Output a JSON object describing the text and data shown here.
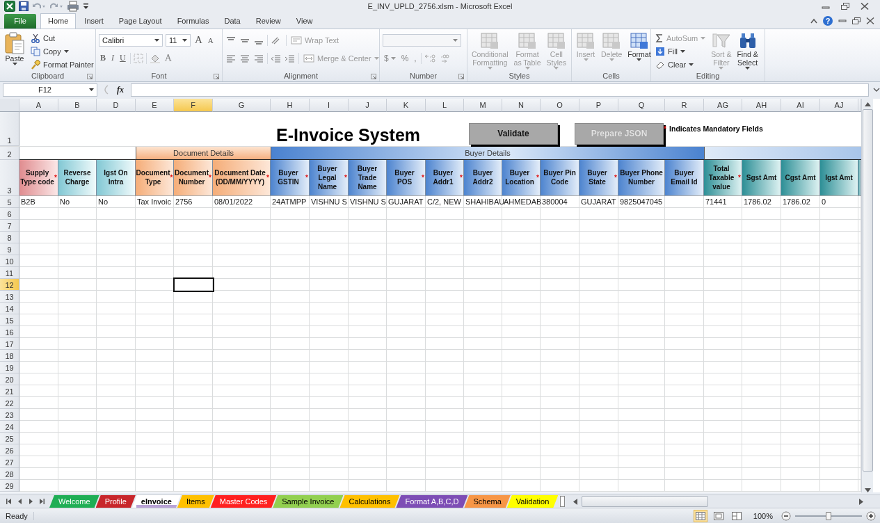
{
  "window": {
    "title": "E_INV_UPLD_2756.xlsm - Microsoft Excel",
    "help_label": "?"
  },
  "ribbon_tabs": [
    {
      "label": "File",
      "kind": "file",
      "selected": false
    },
    {
      "label": "Home",
      "kind": "tab",
      "selected": true
    },
    {
      "label": "Insert",
      "kind": "tab",
      "selected": false
    },
    {
      "label": "Page Layout",
      "kind": "tab",
      "selected": false
    },
    {
      "label": "Formulas",
      "kind": "tab",
      "selected": false
    },
    {
      "label": "Data",
      "kind": "tab",
      "selected": false
    },
    {
      "label": "Review",
      "kind": "tab",
      "selected": false
    },
    {
      "label": "View",
      "kind": "tab",
      "selected": false
    }
  ],
  "ribbon": {
    "groups": [
      {
        "kind": "clipboard",
        "label": "Clipboard",
        "items": [
          {
            "label": "Paste",
            "disabled": false,
            "menu": true
          },
          {
            "label": "Cut",
            "disabled": false,
            "menu": false
          },
          {
            "label": "Copy",
            "disabled": false,
            "menu": true
          },
          {
            "label": "Format Painter",
            "disabled": false,
            "menu": false
          }
        ]
      },
      {
        "kind": "font",
        "label": "Font",
        "font_name": "Calibri",
        "font_size": "11",
        "grow": "A",
        "shrink": "A",
        "styles": [
          "B",
          "I",
          "U"
        ],
        "font_color": "A"
      },
      {
        "kind": "alignment",
        "label": "Alignment",
        "items": [
          {
            "label": "Wrap Text",
            "disabled": true,
            "menu": false
          },
          {
            "label": "Merge & Center",
            "disabled": true,
            "menu": true
          }
        ]
      },
      {
        "kind": "number",
        "label": "Number",
        "symbols": [
          {
            "label": "$",
            "disabled": true,
            "menu": true
          },
          {
            "label": "%",
            "disabled": true,
            "menu": false
          },
          {
            "label": ",",
            "disabled": true,
            "menu": false
          }
        ]
      },
      {
        "kind": "large",
        "label": "Styles",
        "items": [
          {
            "lines": [
              "Conditional",
              "Formatting"
            ],
            "disabled": true,
            "menu": true
          },
          {
            "lines": [
              "Format",
              "as Table"
            ],
            "disabled": true,
            "menu": true
          },
          {
            "lines": [
              "Cell",
              "Styles"
            ],
            "disabled": true,
            "menu": true
          }
        ]
      },
      {
        "kind": "large",
        "label": "Cells",
        "items": [
          {
            "lines": [
              "Insert"
            ],
            "disabled": true,
            "menu": true
          },
          {
            "lines": [
              "Delete"
            ],
            "disabled": true,
            "menu": true
          },
          {
            "lines": [
              "Format"
            ],
            "disabled": false,
            "menu": true
          }
        ]
      },
      {
        "kind": "editing",
        "label": "Editing",
        "items": [
          {
            "label": "AutoSum",
            "disabled": true,
            "menu": true
          },
          {
            "label": "Fill",
            "disabled": false,
            "menu": true
          },
          {
            "label": "Clear",
            "disabled": false,
            "menu": true
          }
        ],
        "large": [
          {
            "lines": [
              "Sort &",
              "Filter"
            ],
            "disabled": true,
            "menu": true
          },
          {
            "lines": [
              "Find &",
              "Select"
            ],
            "disabled": false,
            "menu": true
          }
        ]
      }
    ]
  },
  "formula_bar": {
    "name_box": "F12",
    "fx_label": "fx"
  },
  "sheet": {
    "columns": [
      {
        "label": "A",
        "selected": false
      },
      {
        "label": "B",
        "selected": false
      },
      {
        "label": "D",
        "selected": false
      },
      {
        "label": "E",
        "selected": false
      },
      {
        "label": "F",
        "selected": true
      },
      {
        "label": "G",
        "selected": false
      },
      {
        "label": "H",
        "selected": false
      },
      {
        "label": "I",
        "selected": false
      },
      {
        "label": "J",
        "selected": false
      },
      {
        "label": "K",
        "selected": false
      },
      {
        "label": "L",
        "selected": false
      },
      {
        "label": "M",
        "selected": false
      },
      {
        "label": "N",
        "selected": false
      },
      {
        "label": "O",
        "selected": false
      },
      {
        "label": "P",
        "selected": false
      },
      {
        "label": "Q",
        "selected": false
      },
      {
        "label": "R",
        "selected": false
      },
      {
        "label": "AG",
        "selected": false
      },
      {
        "label": "AH",
        "selected": false
      },
      {
        "label": "AI",
        "selected": false
      },
      {
        "label": "AJ",
        "selected": false
      }
    ],
    "title_row": {
      "label": "1",
      "title": "E-Invoice System",
      "buttons": [
        {
          "label": "Validate",
          "disabled": false
        },
        {
          "label": "Prepare JSON",
          "disabled": true
        }
      ],
      "note": {
        "mark": "*",
        "text": "Indicates Mandatory Fields"
      }
    },
    "band_row": {
      "label": "2",
      "bands": [
        {
          "kind": "document",
          "label": "Document Details"
        },
        {
          "kind": "buyer",
          "label": "Buyer Details"
        },
        {
          "kind": "value"
        }
      ]
    },
    "header_row": {
      "label": "3",
      "cells": [
        {
          "text": "Supply Type code",
          "kind": "supply",
          "mark": "*"
        },
        {
          "text": "Reverse Charge",
          "kind": "misc"
        },
        {
          "text": "Igst On Intra",
          "kind": "misc"
        },
        {
          "text": "Document Type",
          "kind": "document",
          "mark": "*"
        },
        {
          "text": "Document Number",
          "kind": "document",
          "mark": "*"
        },
        {
          "text": "Document Date (DD/MM/YYYY)",
          "kind": "document",
          "mark": "*"
        },
        {
          "text": "Buyer GSTIN",
          "kind": "buyer",
          "mark": "*"
        },
        {
          "text": "Buyer Legal Name",
          "kind": "buyer",
          "mark": "*"
        },
        {
          "text": "Buyer Trade Name",
          "kind": "buyer"
        },
        {
          "text": "Buyer POS",
          "kind": "buyer",
          "mark": "*"
        },
        {
          "text": "Buyer Addr1",
          "kind": "buyer",
          "mark": "*"
        },
        {
          "text": "Buyer Addr2",
          "kind": "buyer"
        },
        {
          "text": "Buyer Location",
          "kind": "buyer",
          "mark": "*"
        },
        {
          "text": "Buyer Pin Code",
          "kind": "buyer"
        },
        {
          "text": "Buyer State",
          "kind": "buyer",
          "mark": "*"
        },
        {
          "text": "Buyer Phone Number",
          "kind": "buyer"
        },
        {
          "text": "Buyer Email Id",
          "kind": "buyer"
        },
        {
          "text": "Total Taxable value",
          "kind": "value",
          "mark": "*"
        },
        {
          "text": "Sgst Amt",
          "kind": "value"
        },
        {
          "text": "Cgst Amt",
          "kind": "value"
        },
        {
          "text": "Igst Amt",
          "kind": "value"
        }
      ]
    },
    "data_rows": [
      {
        "label": "5",
        "selected": false,
        "cells": [
          "B2B",
          "No",
          "No",
          "Tax Invoic",
          "2756",
          "08/01/2022",
          "24ATMPP",
          "VISHNU S",
          "VISHNU S",
          "GUJARAT",
          "C/2, NEW",
          "SHAHIBAU",
          "AHMEDAB",
          "380004",
          "GUJARAT",
          "9825047045",
          null,
          "71441",
          "1786.02",
          "1786.02",
          "0"
        ]
      }
    ],
    "empty_rows": [
      {
        "label": "6",
        "selected": false
      },
      {
        "label": "7",
        "selected": false
      },
      {
        "label": "8",
        "selected": false
      },
      {
        "label": "9",
        "selected": false
      },
      {
        "label": "10",
        "selected": false
      },
      {
        "label": "11",
        "selected": false
      },
      {
        "label": "12",
        "selected": true
      },
      {
        "label": "13",
        "selected": false
      },
      {
        "label": "14",
        "selected": false
      },
      {
        "label": "15",
        "selected": false
      },
      {
        "label": "16",
        "selected": false
      },
      {
        "label": "17",
        "selected": false
      },
      {
        "label": "18",
        "selected": false
      },
      {
        "label": "19",
        "selected": false
      },
      {
        "label": "20",
        "selected": false
      },
      {
        "label": "21",
        "selected": false
      },
      {
        "label": "22",
        "selected": false
      },
      {
        "label": "23",
        "selected": false
      },
      {
        "label": "24",
        "selected": false
      },
      {
        "label": "25",
        "selected": false
      },
      {
        "label": "26",
        "selected": false
      },
      {
        "label": "27",
        "selected": false
      },
      {
        "label": "28",
        "selected": false
      },
      {
        "label": "29",
        "selected": false
      }
    ]
  },
  "sheet_tabs": [
    {
      "label": "Welcome",
      "color": "#1fae55",
      "selected": false
    },
    {
      "label": "Profile",
      "color": "#c8262b",
      "selected": false
    },
    {
      "label": "eInvoice",
      "color": "#b9a3d6",
      "selected": true
    },
    {
      "label": "Items",
      "color": "#ffc000",
      "selected": false
    },
    {
      "label": "Master Codes",
      "color": "#ff2020",
      "selected": false
    },
    {
      "label": "Sample Invoice",
      "color": "#92d050",
      "selected": false
    },
    {
      "label": "Calculations",
      "color": "#ffc000",
      "selected": false
    },
    {
      "label": "Format A,B,C,D",
      "color": "#7d4db5",
      "selected": false
    },
    {
      "label": "Schema",
      "color": "#f79646",
      "selected": false
    },
    {
      "label": "Validation",
      "color": "#ffff00",
      "selected": false
    }
  ],
  "status_bar": {
    "status": "Ready",
    "views": [
      {
        "selected": true
      },
      {
        "selected": false
      },
      {
        "selected": false
      }
    ],
    "zoom": "100%",
    "zoom_slider": {
      "level": 0.5
    }
  }
}
